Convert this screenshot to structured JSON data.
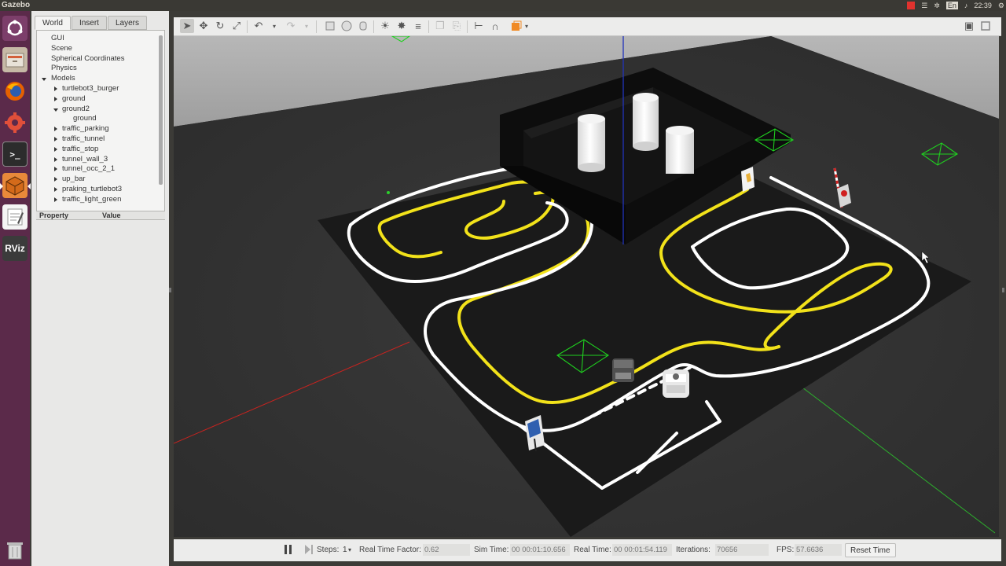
{
  "app": {
    "title": "Gazebo"
  },
  "tray": {
    "keyboard": "En",
    "time": "22:39"
  },
  "launcher": {
    "rviz_label": "RViz"
  },
  "left_panel": {
    "tabs": [
      "World",
      "Insert",
      "Layers"
    ],
    "tree": {
      "items": [
        "GUI",
        "Scene",
        "Spherical Coordinates",
        "Physics"
      ],
      "models_label": "Models",
      "models": {
        "a": "turtlebot3_burger",
        "b": "ground",
        "c": "ground2",
        "c_child": "ground",
        "d": "traffic_parking",
        "e": "traffic_tunnel",
        "f": "traffic_stop",
        "g": "tunnel_wall_3",
        "h": "tunnel_occ_2_1",
        "i": "up_bar",
        "j": "praking_turtlebot3",
        "k": "traffic_light_green"
      }
    },
    "property_header": {
      "property": "Property",
      "value": "Value"
    }
  },
  "bottom_bar": {
    "steps_label": "Steps:",
    "steps_value": "1",
    "rtf_label": "Real Time Factor:",
    "rtf_value": "0.62",
    "sim_time_label": "Sim Time:",
    "sim_time_value": "00 00:01:10.656",
    "real_time_label": "Real Time:",
    "real_time_value": "00 00:01:54.119",
    "iterations_label": "Iterations:",
    "iterations_value": "70656",
    "fps_label": "FPS:",
    "fps_value": "57.6636",
    "reset_label": "Reset Time"
  },
  "colors": {
    "launcher": "#5b2a4a",
    "track_white": "#ffffff",
    "track_yellow": "#f2e21a",
    "floor": "#2d2d2d",
    "sky": "#a8a8a8"
  }
}
